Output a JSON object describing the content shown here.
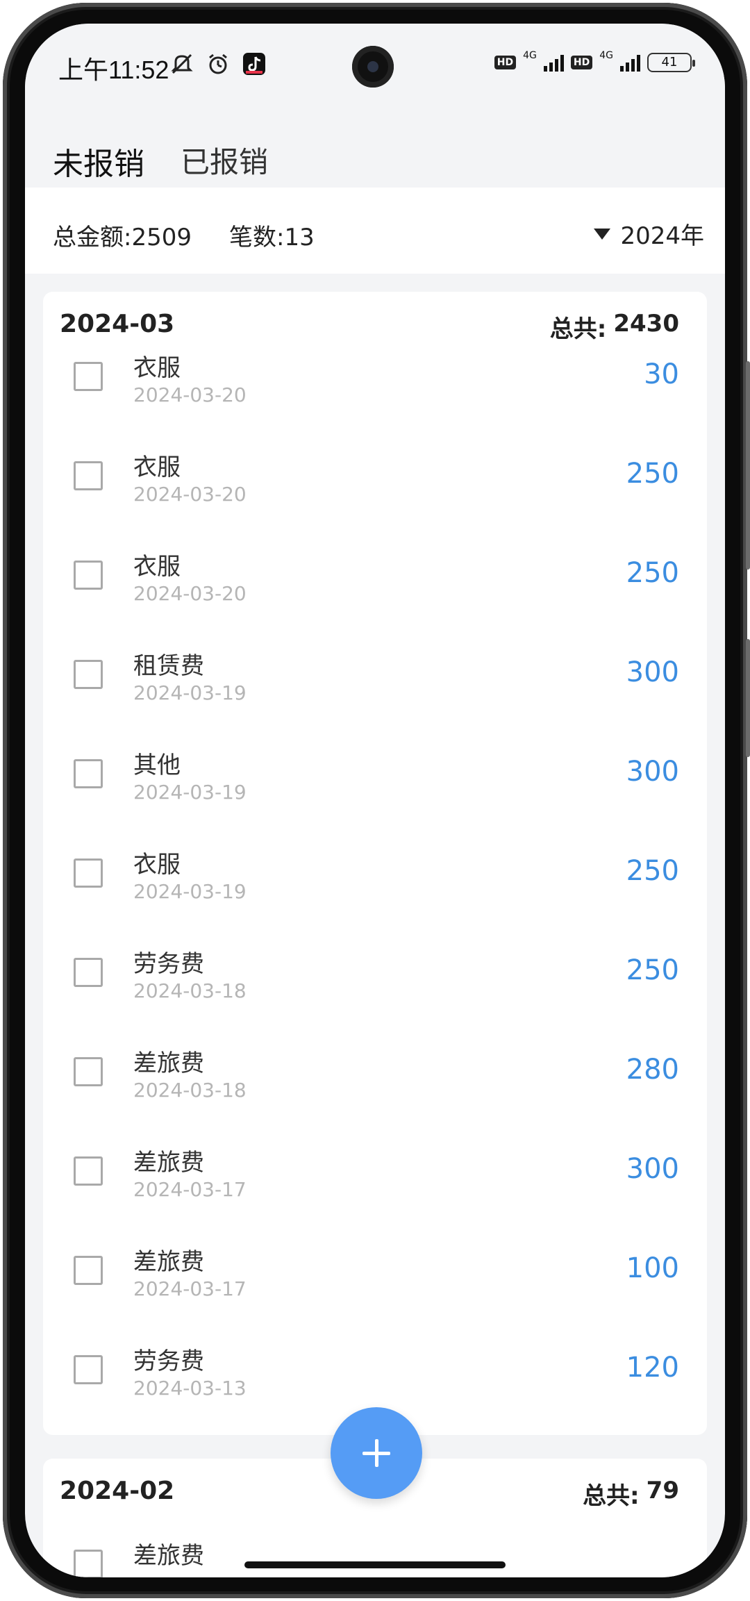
{
  "status_bar": {
    "time": "上午11:52",
    "icons_left": [
      "mute-icon",
      "alarm-icon",
      "douyin-icon"
    ],
    "hd1": "HD",
    "net1": "4G",
    "hd2": "HD",
    "net2": "4G",
    "battery": "41"
  },
  "tabs": [
    {
      "label": "未报销",
      "active": true
    },
    {
      "label": "已报销",
      "active": false
    }
  ],
  "summary": {
    "total": "总金额:2509",
    "count": "笔数:13",
    "year": "2024年"
  },
  "groups": [
    {
      "month": "2024-03",
      "total_label": "总共:",
      "total_value": "2430",
      "items": [
        {
          "name": "衣服",
          "date": "2024-03-20",
          "amount": "30"
        },
        {
          "name": "衣服",
          "date": "2024-03-20",
          "amount": "250"
        },
        {
          "name": "衣服",
          "date": "2024-03-20",
          "amount": "250"
        },
        {
          "name": "租赁费",
          "date": "2024-03-19",
          "amount": "300"
        },
        {
          "name": "其他",
          "date": "2024-03-19",
          "amount": "300"
        },
        {
          "name": "衣服",
          "date": "2024-03-19",
          "amount": "250"
        },
        {
          "name": "劳务费",
          "date": "2024-03-18",
          "amount": "250"
        },
        {
          "name": "差旅费",
          "date": "2024-03-18",
          "amount": "280"
        },
        {
          "name": "差旅费",
          "date": "2024-03-17",
          "amount": "300"
        },
        {
          "name": "差旅费",
          "date": "2024-03-17",
          "amount": "100"
        },
        {
          "name": "劳务费",
          "date": "2024-03-13",
          "amount": "120"
        }
      ]
    },
    {
      "month": "2024-02",
      "total_label": "总共:",
      "total_value": "79",
      "items": [
        {
          "name": "差旅费",
          "date": "",
          "amount": ""
        }
      ]
    }
  ],
  "colors": {
    "accent": "#3b8de0",
    "fab": "#559cf5",
    "background": "#f3f4f6"
  },
  "fab_icon": "plus-icon"
}
